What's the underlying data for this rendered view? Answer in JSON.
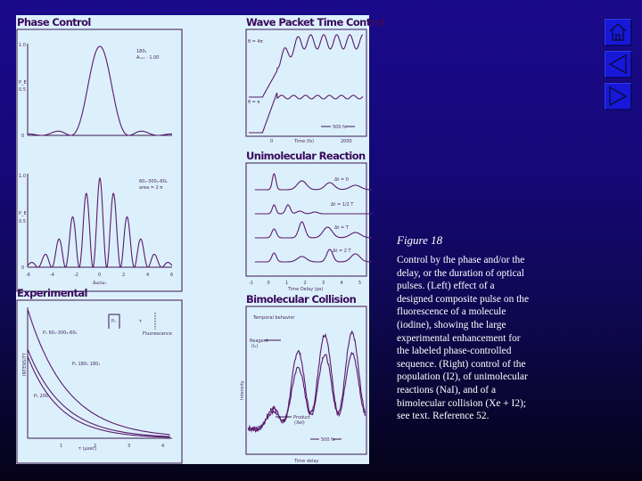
{
  "figure": {
    "panels": {
      "phase_control": {
        "title": "Phase Control",
        "top_plot": {
          "ylabel": "P_E",
          "yticks": [
            "1.0",
            "0.5",
            "0"
          ],
          "annotation_line1": "180₁",
          "annotation_line2": "Aₙₑₒ · 1.00"
        },
        "bottom_plot": {
          "ylabel": "P_E",
          "yticks": [
            "1.0",
            "0.5",
            "0"
          ],
          "xticks": [
            "-6",
            "-4",
            "-2",
            "0",
            "2",
            "4",
            "6"
          ],
          "xlabel": "Δω/ω₁",
          "annotation_line1": "60₁-300₂-60₁",
          "annotation_line2": "area = 2 π"
        }
      },
      "wave_packet": {
        "title": "Wave Packet Time Control",
        "label_upper": "θ = 4π",
        "label_lower": "θ = π",
        "scale_bar": "500 fs",
        "xticks": [
          "0",
          "2000"
        ],
        "xlabel": "Time (fs)"
      },
      "unimolecular": {
        "title": "Unimolecular Reaction",
        "traces": [
          "Δt = 0",
          "Δt = 1/2 T",
          "Δt = T",
          "Δt = 2 T"
        ],
        "xticks": [
          "-1",
          "0",
          "1",
          "2",
          "3",
          "4",
          "5"
        ],
        "xlabel": "Time Delay (ps)"
      },
      "experimental": {
        "title": "Experimental",
        "ylabel": "INTENSITY",
        "xticks": [
          "1",
          "2",
          "3",
          "4"
        ],
        "xlabel": "τ (μsec)",
        "curve_labels": [
          "P₁ 60₁-300₂-60₁",
          "P₁ 180₁ 180₁",
          "P₁ 200₁"
        ],
        "inset_pulse": "P₁",
        "inset_tau": "τ",
        "inset_fluorescence": "Fluorescence"
      },
      "bimolecular": {
        "title": "Bimolecular Collision",
        "subtitle": "Temporal behavior",
        "reagent_label_1": "Reagent",
        "reagent_label_2": "(I₂)",
        "product_label_1": "Product",
        "product_label_2": "(XeI)",
        "scale_bar": "500 fs",
        "ylabel": "Intensity",
        "xlabel": "Time delay"
      }
    }
  },
  "caption": {
    "figure_title": "Figure 18",
    "text": "Control by the phase and/or the delay, or the duration of optical pulses. (Left) effect of a designed composite pulse on the fluorescence of a molecule (iodine), showing the large experimental enhancement for the labeled phase-controlled sequence. (Right) control of the population (I2), of unimolecular reactions (NaI), and of a bimolecular collision (Xe + I2); see text. Reference 52."
  },
  "nav": {
    "home_icon": "home-icon",
    "prev_icon": "triangle-left-icon",
    "next_icon": "triangle-right-icon"
  }
}
